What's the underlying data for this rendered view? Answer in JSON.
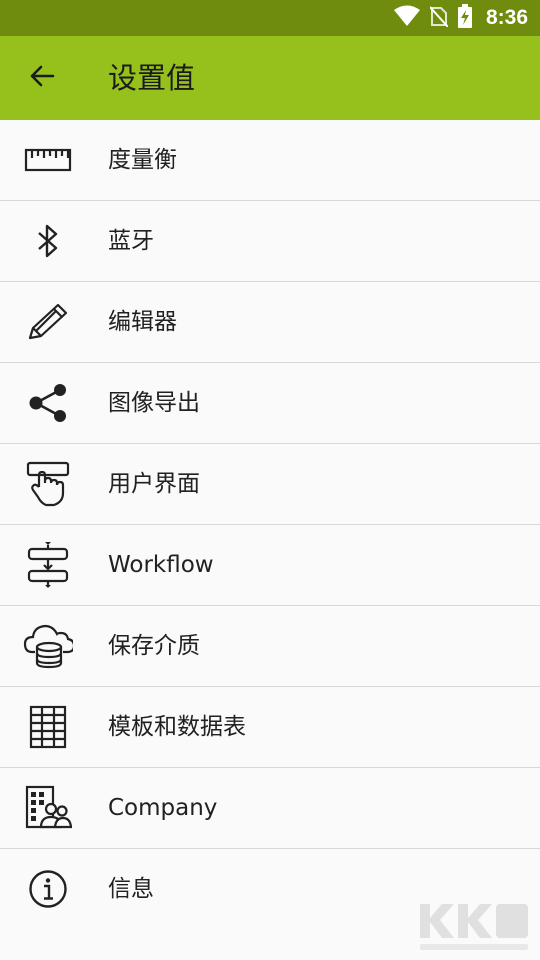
{
  "status_bar": {
    "time": "8:36"
  },
  "app_bar": {
    "title": "设置值"
  },
  "menu": {
    "items": [
      {
        "label": "度量衡",
        "icon": "ruler-icon"
      },
      {
        "label": "蓝牙",
        "icon": "bluetooth-icon"
      },
      {
        "label": "编辑器",
        "icon": "pencil-icon"
      },
      {
        "label": "图像导出",
        "icon": "share-icon"
      },
      {
        "label": "用户界面",
        "icon": "hand-pointer-icon"
      },
      {
        "label": "Workflow",
        "icon": "workflow-icon"
      },
      {
        "label": "保存介质",
        "icon": "cloud-storage-icon"
      },
      {
        "label": "模板和数据表",
        "icon": "table-icon"
      },
      {
        "label": "Company",
        "icon": "company-icon"
      },
      {
        "label": "信息",
        "icon": "info-icon"
      }
    ]
  },
  "colors": {
    "app_bar": "#96c11c",
    "status_bar": "#6f8c0e",
    "background": "#fafafa"
  }
}
